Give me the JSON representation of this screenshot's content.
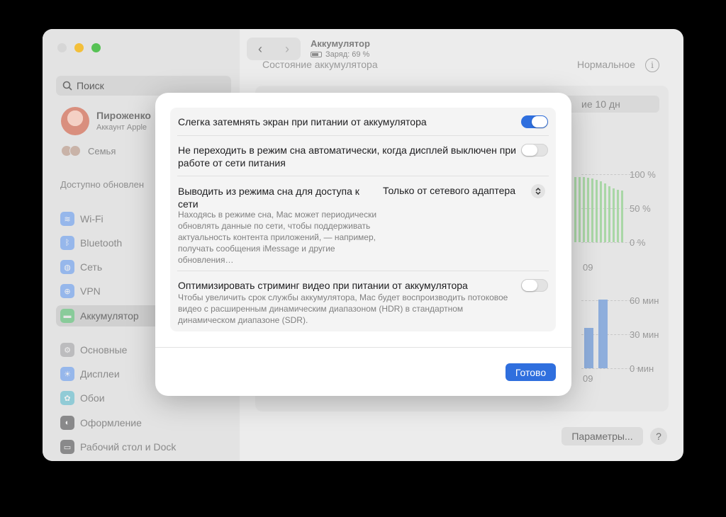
{
  "window": {
    "title": "Аккумулятор",
    "subtitle": "Заряд: 69 %"
  },
  "sidebar": {
    "search_placeholder": "Поиск",
    "profile": {
      "name": "Пироженко",
      "subtitle": "Аккаунт Apple"
    },
    "family_label": "Семья",
    "updates_label": "Доступно обновлен",
    "items": [
      {
        "label": "Wi-Fi",
        "icon": "wifi-icon",
        "color": "#3b82f6"
      },
      {
        "label": "Bluetooth",
        "icon": "bluetooth-icon",
        "color": "#3b82f6"
      },
      {
        "label": "Сеть",
        "icon": "globe-icon",
        "color": "#3b82f6"
      },
      {
        "label": "VPN",
        "icon": "vpn-icon",
        "color": "#3b82f6"
      },
      {
        "label": "Аккумулятор",
        "icon": "battery-icon",
        "color": "#34c759"
      },
      {
        "label": "Основные",
        "icon": "gear-icon",
        "color": "#8e8e93"
      },
      {
        "label": "Дисплеи",
        "icon": "sun-icon",
        "color": "#3b82f6"
      },
      {
        "label": "Обои",
        "icon": "flower-icon",
        "color": "#30b0c7"
      },
      {
        "label": "Оформление",
        "icon": "appearance-icon",
        "color": "#1d1d1f"
      },
      {
        "label": "Рабочий стол и Dock",
        "icon": "dock-icon",
        "color": "#1d1d1f"
      }
    ]
  },
  "content": {
    "section_title": "Состояние аккумулятора",
    "section_status": "Нормальное",
    "range_label": "ие 10 дн",
    "level_axis": [
      "100 %",
      "50 %",
      "0 %"
    ],
    "level_x_label": "09",
    "usage_axis": [
      "60 мин",
      "30 мин",
      "0 мин"
    ],
    "usage_x_label": "09",
    "params_button": "Параметры...",
    "help_button": "?"
  },
  "modal": {
    "rows": [
      {
        "title": "Слегка затемнять экран при питании от аккумулятора",
        "toggle_on": true
      },
      {
        "title": "Не переходить в режим сна автоматически, когда дисплей выключен при работе от сети питания",
        "toggle_on": false
      },
      {
        "title": "Выводить из режима сна для доступа к сети",
        "value": "Только от сетевого адаптера",
        "description": "Находясь в режиме сна, Mac может периодически обновлять данные по сети, чтобы поддерживать актуальность контента приложений, — например, получать сообщения iMessage и другие обновления…"
      },
      {
        "title": "Оптимизировать стриминг видео при питании от аккумулятора",
        "toggle_on": false,
        "description": "Чтобы увеличить срок службы аккумулятора, Mac будет воспроизводить потоковое видео с расширенным динамическим диапазоном (HDR) в стандартном динамическом диапазоне (SDR)."
      }
    ],
    "done_button": "Готово"
  },
  "colors": {
    "accent": "#2f6fde",
    "level_bars": "#a9d7a6",
    "usage_bars": "#8eaedc"
  }
}
